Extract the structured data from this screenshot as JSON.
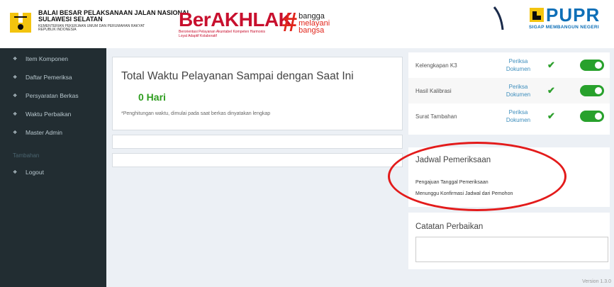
{
  "header": {
    "institution_line1": "BALAI BESAR PELAKSANAAN JALAN NASIONAL",
    "institution_line2": "SULAWESI SELATAN",
    "institution_line3": "KEMENTERIAN PEKERJAAN UMUM DAN PERUMAHAN RAKYAT",
    "institution_line4": "REPUBLIK INDONESIA",
    "berakhlak_title": "BerAKHLAK",
    "berakhlak_tagline": "Berorientasi Pelayanan Akuntabel Kompeten Harmonis Loyal Adaptif Kolaboratif",
    "bangga_hash": "#",
    "bangga_line1": "bangga",
    "bangga_line2": "melayani",
    "bangga_line3": "bangsa",
    "pupr_logo_text": "PUPR",
    "pupr_tagline": "SIGAP MEMBANGUN NEGERI"
  },
  "sidebar": {
    "items": [
      {
        "label": "Item Komponen",
        "icon": "home-icon"
      },
      {
        "label": "Daftar Pemeriksa",
        "icon": "home-icon"
      },
      {
        "label": "Persyaratan Berkas",
        "icon": "home-icon"
      },
      {
        "label": "Waktu Perbaikan",
        "icon": "home-icon"
      },
      {
        "label": "Master Admin",
        "icon": "home-icon"
      }
    ],
    "section_header": "Tambahan",
    "logout_label": "Logout"
  },
  "main": {
    "total_title": "Total Waktu Pelayanan Sampai dengan Saat Ini",
    "total_value": "0 Hari",
    "total_note": "*Penghitungan waktu, dimulai pada saat berkas dinyatakan lengkap"
  },
  "documents": {
    "rows": [
      {
        "label": "Kelengkapan K3",
        "link_line1": "Periksa",
        "link_line2": "Dokumen",
        "checked": "✔"
      },
      {
        "label": "Hasil Kalibrasi",
        "link_line1": "Periksa",
        "link_line2": "Dokumen",
        "checked": "✔"
      },
      {
        "label": "Surat Tambahan",
        "link_line1": "Periksa",
        "link_line2": "Dokumen",
        "checked": "✔"
      }
    ]
  },
  "schedule": {
    "title": "Jadwal Pemeriksaan",
    "line1": "Pengajuan Tanggal Pemeriksaan",
    "line2": "Menunggu Konfirmasi Jadwal dari Pemohon"
  },
  "notes": {
    "title": "Catatan Perbaikan",
    "value": ""
  },
  "footer": {
    "version": "Version 1.3.0"
  },
  "colors": {
    "sidebar_bg": "#222d32",
    "accent_green": "#28a12c",
    "link_blue": "#3c8dbc",
    "highlight_red": "#e31b1b"
  }
}
